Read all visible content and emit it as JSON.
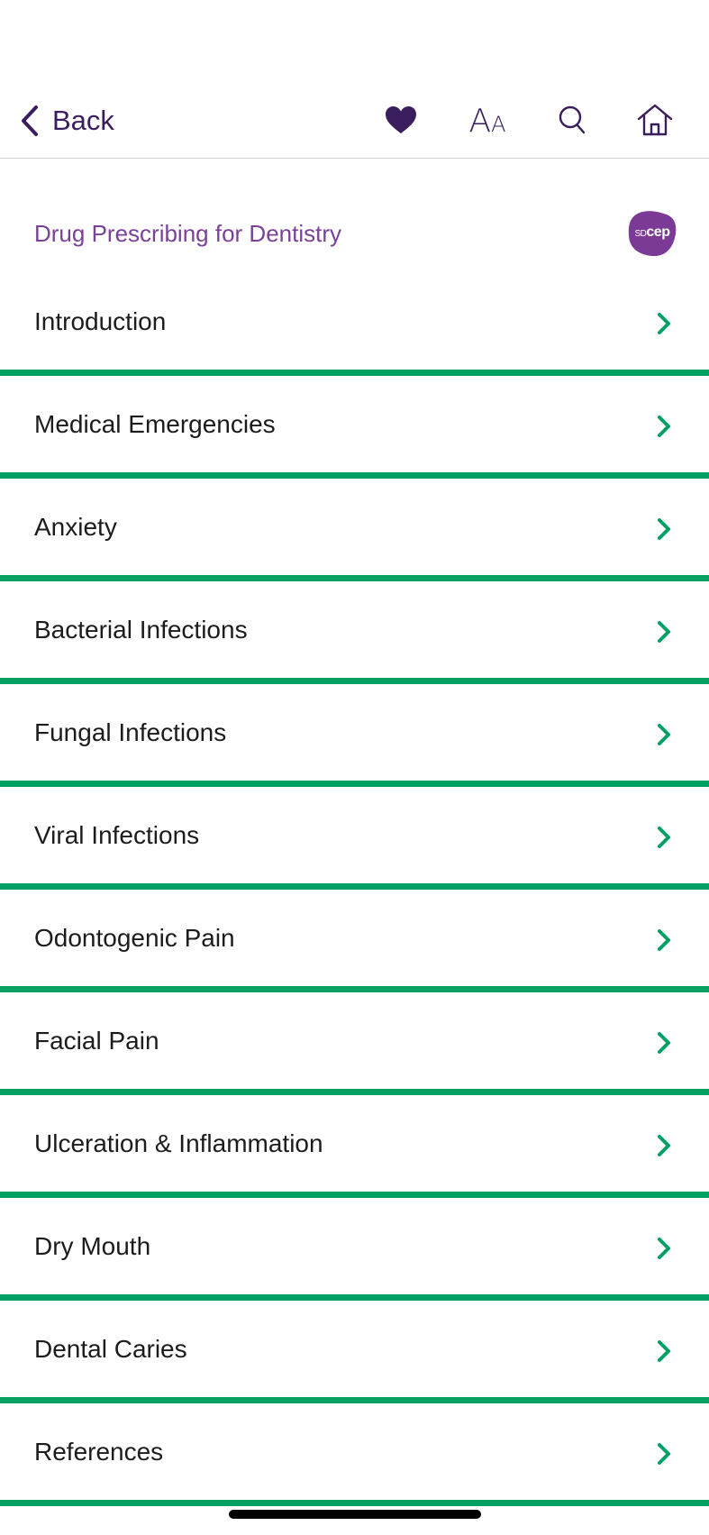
{
  "nav": {
    "back_label": "Back",
    "text_size_big": "A",
    "text_size_small": "A"
  },
  "section": {
    "title": "Drug Prescribing for Dentistry",
    "logo_prefix": "SD",
    "logo_suffix": "cep"
  },
  "colors": {
    "accent_purple": "#3a1d5c",
    "title_purple": "#7a4296",
    "divider_green": "#00a064",
    "logo_purple": "#7b3a96"
  },
  "icons": {
    "back": "chevron-left-icon",
    "favorite": "heart-icon",
    "text_size": "text-size-icon",
    "search": "search-icon",
    "home": "home-icon",
    "row": "chevron-right-icon"
  },
  "items": [
    {
      "label": "Introduction"
    },
    {
      "label": "Medical Emergencies"
    },
    {
      "label": "Anxiety"
    },
    {
      "label": "Bacterial Infections"
    },
    {
      "label": "Fungal Infections"
    },
    {
      "label": "Viral Infections"
    },
    {
      "label": "Odontogenic Pain"
    },
    {
      "label": "Facial Pain"
    },
    {
      "label": "Ulceration & Inflammation"
    },
    {
      "label": "Dry Mouth"
    },
    {
      "label": "Dental Caries"
    },
    {
      "label": "References"
    }
  ]
}
